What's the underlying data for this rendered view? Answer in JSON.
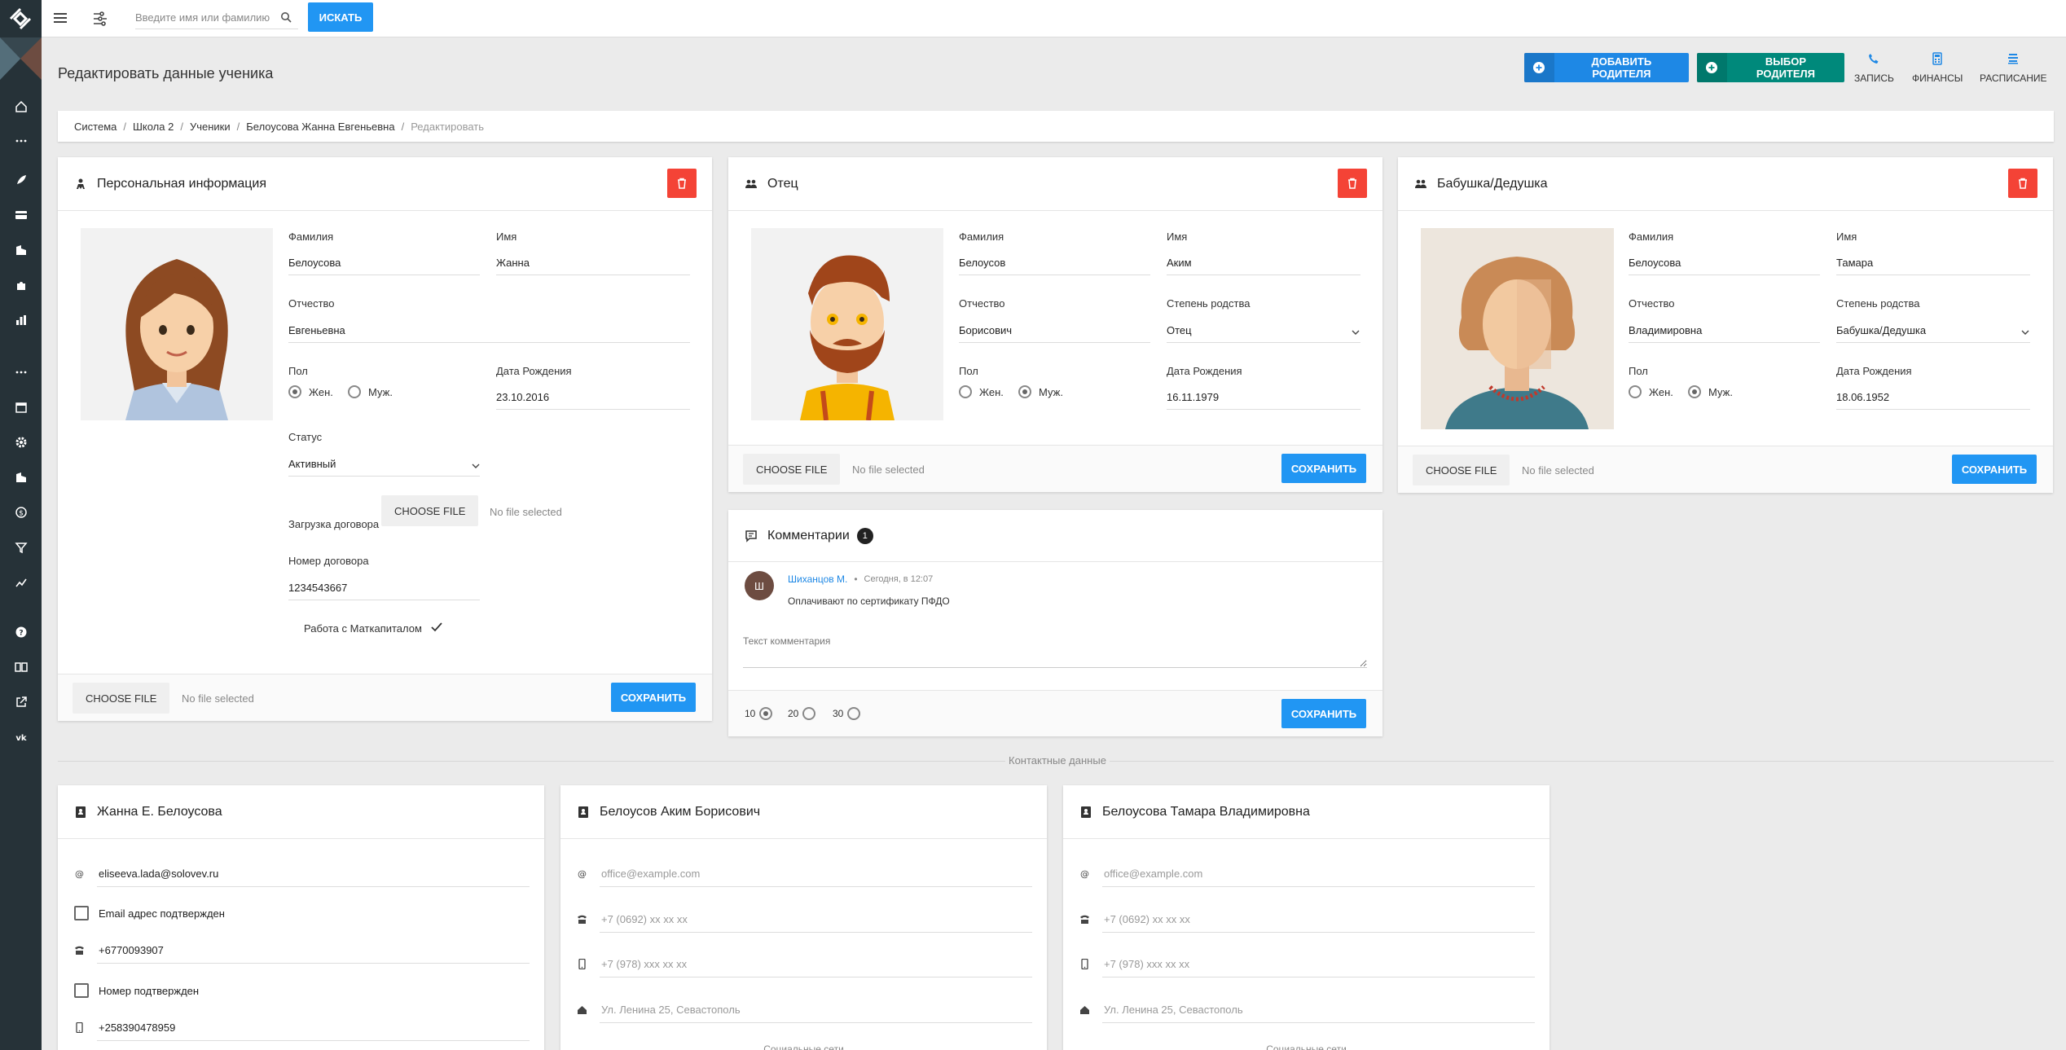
{
  "topbar": {
    "search_placeholder": "Введите имя или фамилию",
    "search_button": "ИСКАТЬ"
  },
  "header": {
    "title": "Редактировать данные ученика",
    "add_parent": "ДОБАВИТЬ РОДИТЕЛЯ",
    "choose_parent": "ВЫБОР РОДИТЕЛЯ",
    "links": [
      "ЗАПИСЬ",
      "ФИНАНСЫ",
      "РАСПИСАНИЕ"
    ]
  },
  "breadcrumb": [
    "Система",
    "Школа 2",
    "Ученики",
    "Белоусова Жанна Евгеньевна",
    "Редактировать"
  ],
  "personal": {
    "title": "Персональная информация",
    "surname_label": "Фамилия",
    "surname": "Белоусова",
    "name_label": "Имя",
    "name": "Жанна",
    "patronymic_label": "Отчество",
    "patronymic": "Евгеньевна",
    "gender_label": "Пол",
    "female": "Жен.",
    "male": "Муж.",
    "birth_label": "Дата Рождения",
    "birth": "23.10.2016",
    "status_label": "Статус",
    "status": "Активный",
    "contract_upload_label": "Загрузка договора",
    "contract_no_label": "Номер договора",
    "contract_no": "1234543667",
    "matcapital": "Работа с Маткапиталом"
  },
  "father": {
    "title": "Отец",
    "surname_label": "Фамилия",
    "surname": "Белоусов",
    "name_label": "Имя",
    "name": "Аким",
    "patronymic_label": "Отчество",
    "patronymic": "Борисович",
    "relation_label": "Степень родства",
    "relation": "Отец",
    "gender_label": "Пол",
    "female": "Жен.",
    "male": "Муж.",
    "birth_label": "Дата Рождения",
    "birth": "16.11.1979"
  },
  "grandparent": {
    "title": "Бабушка/Дедушка",
    "surname_label": "Фамилия",
    "surname": "Белоусова",
    "name_label": "Имя",
    "name": "Тамара",
    "patronymic_label": "Отчество",
    "patronymic": "Владимировна",
    "relation_label": "Степень родства",
    "relation": "Бабушка/Дедушка",
    "gender_label": "Пол",
    "female": "Жен.",
    "male": "Муж.",
    "birth_label": "Дата Рождения",
    "birth": "18.06.1952"
  },
  "file": {
    "choose": "CHOOSE FILE",
    "none": "No file selected",
    "save": "СОХРАНИТЬ"
  },
  "comments": {
    "title": "Комментарии",
    "count": "1",
    "author_initial": "Ш",
    "author": "Шиханцов М.",
    "time": "Сегодня, в 12:07",
    "text": "Оплачивают по сертификату ПФДО",
    "placeholder": "Текст комментария",
    "page_sizes": [
      "10",
      "20",
      "30"
    ]
  },
  "contacts": {
    "divider": "Контактные данные",
    "social": "Социальные сети",
    "student": {
      "title": "Жанна Е. Белоусова",
      "email": "eliseeva.lada@solovev.ru",
      "email_confirmed": "Email адрес подтвержден",
      "phone": "+6770093907",
      "phone_confirmed": "Номер подтвержден",
      "mobile": "+258390478959"
    },
    "father": {
      "title": "Белоусов Аким Борисович",
      "email_ph": "office@example.com",
      "phone_ph": "+7 (0692) xx xx xx",
      "mobile_ph": "+7 (978) xxx xx xx",
      "address_ph": "Ул. Ленина 25, Севастополь"
    },
    "grandparent": {
      "title": "Белоусова Тамара Владимировна",
      "email_ph": "office@example.com",
      "phone_ph": "+7 (0692) xx xx xx",
      "mobile_ph": "+7 (978) xxx xx xx",
      "address_ph": "Ул. Ленина 25, Севастополь"
    }
  }
}
